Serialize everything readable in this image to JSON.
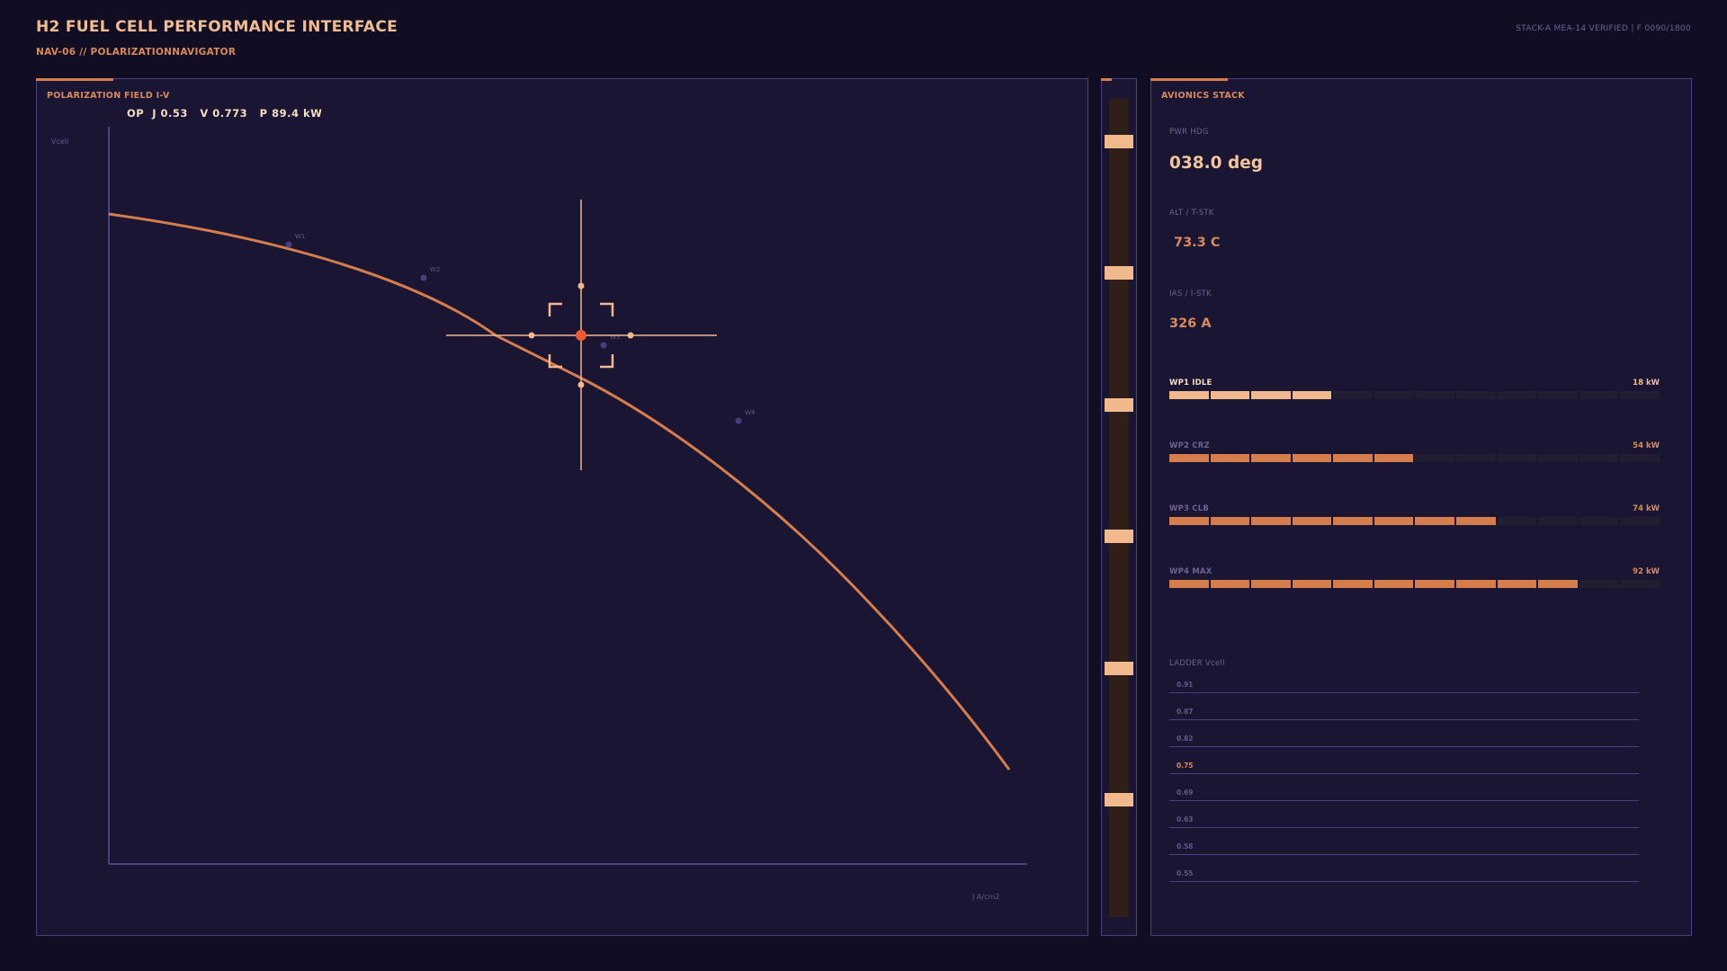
{
  "header": {
    "title": "H2 FUEL CELL PERFORMANCE INTERFACE",
    "subtitle": "NAV-06 // POLARIZATIONNAVIGATOR",
    "status": "STACK-A MEA-14 VERIFIED | F 0090/1800"
  },
  "plot_panel": {
    "label": "POLARIZATION FIELD I-V",
    "op_readout": "OP  J 0.53   V 0.773   P 89.4 kW",
    "y_axis_label": "Vcell",
    "x_axis_label": "J  A/cm2",
    "waypoints": [
      "W1",
      "W2",
      "W3",
      "W4"
    ],
    "operating_point": {
      "J": 0.53,
      "V": 0.773,
      "P_kW": 89.4
    }
  },
  "scale_slider": {
    "marks": 6
  },
  "avionics": {
    "label": "AVIONICS STACK",
    "fields": [
      {
        "label": "PWR HDG",
        "value": "038.0 deg"
      },
      {
        "label": "ALT / T-STK",
        "value": "73.3 C"
      },
      {
        "label": "IAS / I-STK",
        "value": "326 A"
      }
    ],
    "waypoint_bars": [
      {
        "name": "WP1 IDLE",
        "value": "18 kW",
        "filled_segments": 4,
        "total_segments": 12,
        "active": true
      },
      {
        "name": "WP2 CRZ",
        "value": "54 kW",
        "filled_segments": 6,
        "total_segments": 12,
        "active": false
      },
      {
        "name": "WP3 CLB",
        "value": "74 kW",
        "filled_segments": 8,
        "total_segments": 12,
        "active": false
      },
      {
        "name": "WP4 MAX",
        "value": "92 kW",
        "filled_segments": 10,
        "total_segments": 12,
        "active": false
      }
    ],
    "ladder": {
      "title": "LADDER Vcell",
      "values": [
        "0.91",
        "0.87",
        "0.82",
        "0.75",
        "0.69",
        "0.63",
        "0.58",
        "0.55"
      ],
      "highlight": "0.75"
    }
  },
  "colors": {
    "background": "#110d22",
    "panel": "#1a1533",
    "border": "#4b4084",
    "curve": "#d67d4e",
    "accent_light": "#f2b88e",
    "reticle_center": "#ee5a32",
    "bar_idle": "#f2b88e",
    "bar_other": "#d67d4e"
  },
  "chart_data": {
    "type": "line",
    "title": "POLARIZATION FIELD I-V",
    "xlabel": "J  A/cm2",
    "ylabel": "Vcell",
    "series": [
      {
        "values_x": [
          0.0,
          0.18,
          0.34,
          0.53,
          0.71,
          1.0
        ],
        "values_y": [
          0.95,
          0.91,
          0.87,
          0.773,
          0.69,
          0.3
        ]
      }
    ],
    "waypoints": [
      {
        "name": "W1",
        "x": 0.18,
        "y": 0.91
      },
      {
        "name": "W2",
        "x": 0.34,
        "y": 0.87
      },
      {
        "name": "W3",
        "x": 0.56,
        "y": 0.76
      },
      {
        "name": "W4",
        "x": 0.71,
        "y": 0.69
      }
    ],
    "grid": false
  }
}
